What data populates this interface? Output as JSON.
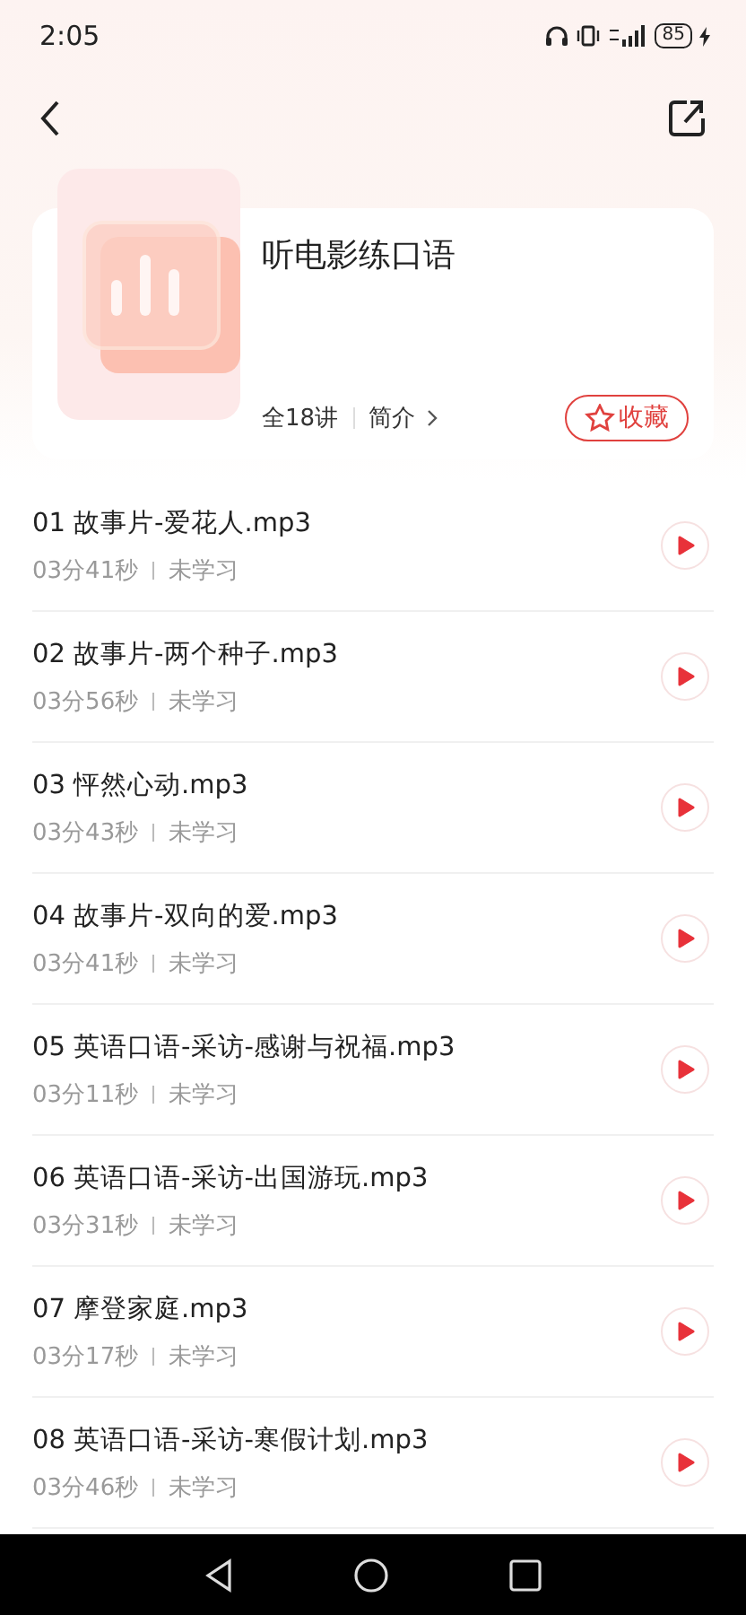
{
  "status_bar": {
    "time": "2:05",
    "battery": "85"
  },
  "course": {
    "title": "听电影练口语",
    "count": "全18讲",
    "intro": "简介",
    "favorite": {
      "label": "收藏",
      "favorited": false
    }
  },
  "episodes": [
    {
      "title": "01 故事片-爱花人.mp3",
      "duration": "03分41秒",
      "status": "未学习"
    },
    {
      "title": "02 故事片-两个种子.mp3",
      "duration": "03分56秒",
      "status": "未学习"
    },
    {
      "title": "03 怦然心动.mp3",
      "duration": "03分43秒",
      "status": "未学习"
    },
    {
      "title": "04 故事片-双向的爱.mp3",
      "duration": "03分41秒",
      "status": "未学习"
    },
    {
      "title": "05 英语口语-采访-感谢与祝福.mp3",
      "duration": "03分11秒",
      "status": "未学习"
    },
    {
      "title": "06 英语口语-采访-出国游玩.mp3",
      "duration": "03分31秒",
      "status": "未学习"
    },
    {
      "title": "07 摩登家庭.mp3",
      "duration": "03分17秒",
      "status": "未学习"
    },
    {
      "title": "08 英语口语-采访-寒假计划.mp3",
      "duration": "03分46秒",
      "status": "未学习"
    }
  ]
}
